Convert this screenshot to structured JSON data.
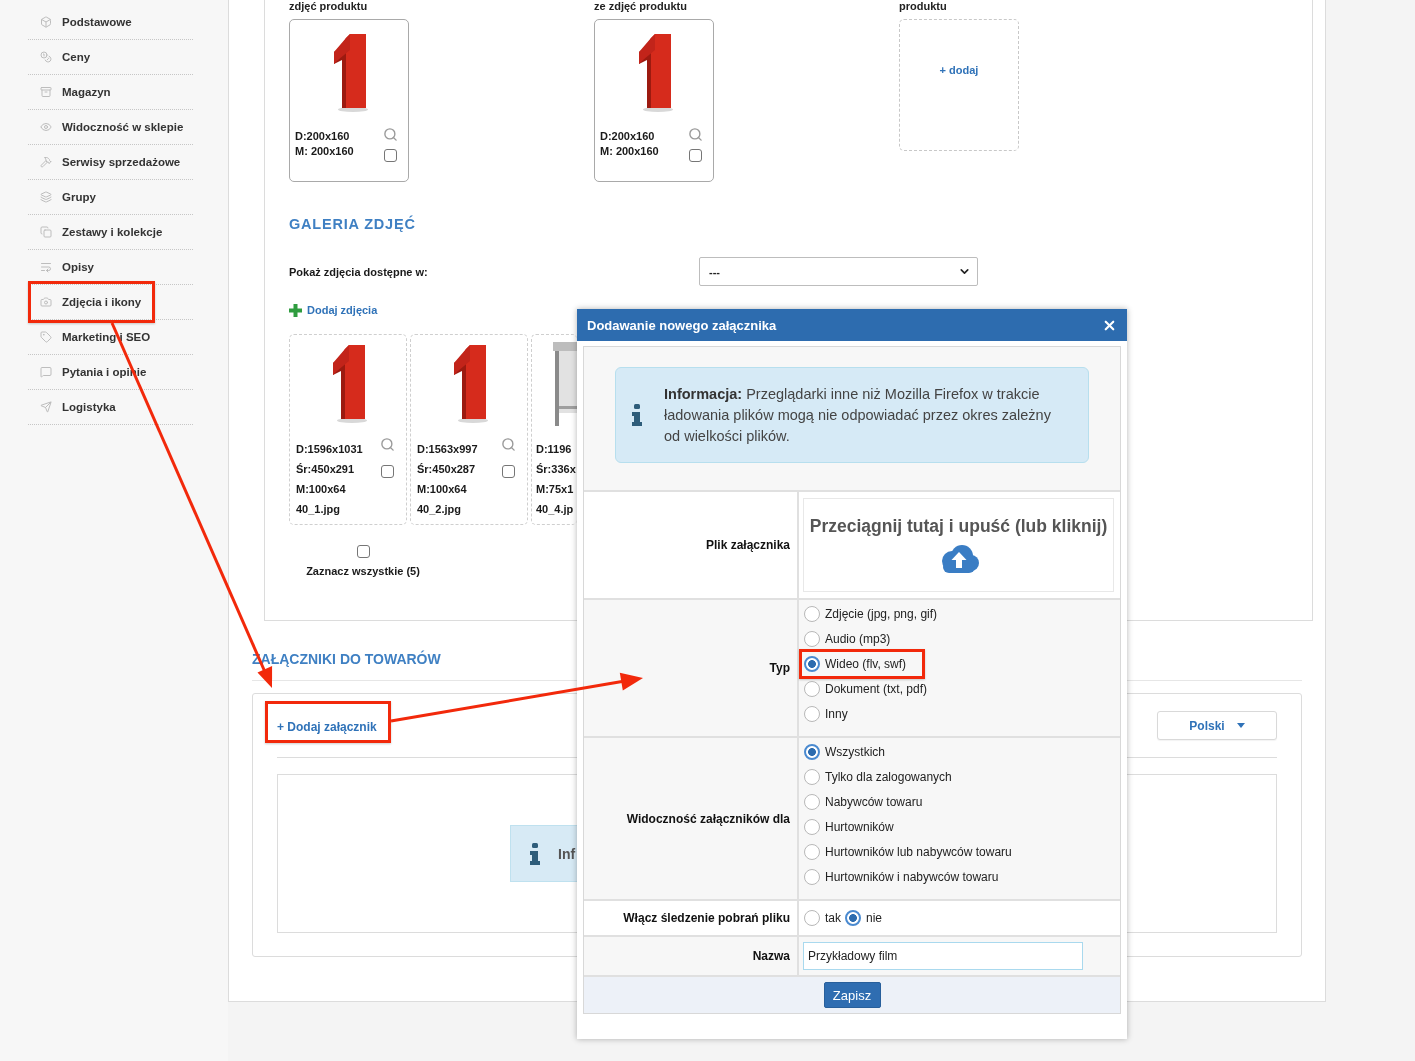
{
  "sidebar": {
    "items": [
      {
        "label": "Podstawowe",
        "highlighted": false
      },
      {
        "label": "Ceny",
        "highlighted": false
      },
      {
        "label": "Magazyn",
        "highlighted": false
      },
      {
        "label": "Widoczność w sklepie",
        "highlighted": false
      },
      {
        "label": "Serwisy sprzedażowe",
        "highlighted": false
      },
      {
        "label": "Grupy",
        "highlighted": false
      },
      {
        "label": "Zestawy i kolekcje",
        "highlighted": false
      },
      {
        "label": "Opisy",
        "highlighted": false
      },
      {
        "label": "Zdjęcia i ikony",
        "highlighted": true
      },
      {
        "label": "Marketing i SEO",
        "highlighted": false
      },
      {
        "label": "Pytania i opinie",
        "highlighted": false
      },
      {
        "label": "Logistyka",
        "highlighted": false
      }
    ]
  },
  "main_images": [
    {
      "kind": "image",
      "caption": "zdjęć produktu",
      "lines": [
        "D:200x160",
        "M: 200x160"
      ],
      "checked": false
    },
    {
      "kind": "image",
      "caption": "ze zdjęć produktu",
      "lines": [
        "D:200x160",
        "M: 200x160"
      ],
      "checked": false
    },
    {
      "kind": "empty",
      "caption": "produktu",
      "add_label": "+ dodaj"
    }
  ],
  "gallery": {
    "title": "GALERIA ZDJĘĆ",
    "filter_label": "Pokaż zdjęcia dostępne w:",
    "filter_value": "---",
    "add_label": "Dodaj zdjęcia",
    "photos": [
      {
        "kind": "digit",
        "lines": [
          "D:1596x1031",
          "Śr:450x291",
          "M:100x64",
          "40_1.jpg"
        ],
        "checked": false
      },
      {
        "kind": "digit",
        "lines": [
          "D:1563x997",
          "Śr:450x287",
          "M:100x64",
          "40_2.jpg"
        ],
        "checked": false
      },
      {
        "kind": "stand",
        "lines": [
          "D:1196",
          "Śr:336x",
          "M:75x1",
          "40_4.jp"
        ]
      }
    ],
    "select_all": {
      "label": "Zaznacz wszystkie (5)",
      "checked": false
    }
  },
  "attachments": {
    "title": "ZAŁĄCZNIKI DO TOWARÓW",
    "add_button": {
      "label": "+ Dodaj załącznik",
      "highlighted": true
    },
    "language": "Polski",
    "notice": "Inf"
  },
  "dialog": {
    "title": "Dodawanie nowego załącznika",
    "info": "**Informacja:** Przeglądarki inne niż Mozilla Firefox w trakcie ładowania plików mogą nie odpowiadać przez okres zależny od wielkości plików.",
    "rows": [
      {
        "kind": "dropzone",
        "label": "Plik załącznika",
        "text": "Przeciągnij tutaj i upuść (lub kliknij)"
      },
      {
        "kind": "radio_list",
        "label": "Typ",
        "options": [
          {
            "label": "Zdjęcie (jpg, png, gif)",
            "selected": false,
            "highlighted": false
          },
          {
            "label": "Audio (mp3)",
            "selected": false,
            "highlighted": false
          },
          {
            "label": "Wideo (flv, swf)",
            "selected": true,
            "highlighted": true
          },
          {
            "label": "Dokument (txt, pdf)",
            "selected": false,
            "highlighted": false
          },
          {
            "label": "Inny",
            "selected": false,
            "highlighted": false
          }
        ]
      },
      {
        "kind": "radio_list",
        "label": "Widoczność załączników dla",
        "options": [
          {
            "label": "Wszystkich",
            "selected": true,
            "highlighted": false
          },
          {
            "label": "Tylko dla zalogowanych",
            "selected": false,
            "highlighted": false
          },
          {
            "label": "Nabywców towaru",
            "selected": false,
            "highlighted": false
          },
          {
            "label": "Hurtowników",
            "selected": false,
            "highlighted": false
          },
          {
            "label": "Hurtowników lub nabywców towaru",
            "selected": false,
            "highlighted": false
          },
          {
            "label": "Hurtowników i nabywców towaru",
            "selected": false,
            "highlighted": false
          }
        ]
      },
      {
        "kind": "radio_inline",
        "label": "Włącz śledzenie pobrań pliku",
        "options": [
          {
            "label": "tak",
            "selected": false
          },
          {
            "label": "nie",
            "selected": true
          }
        ]
      },
      {
        "kind": "text_input",
        "label": "Nazwa",
        "value": "Przykładowy film"
      }
    ],
    "submit": "Zapisz"
  }
}
